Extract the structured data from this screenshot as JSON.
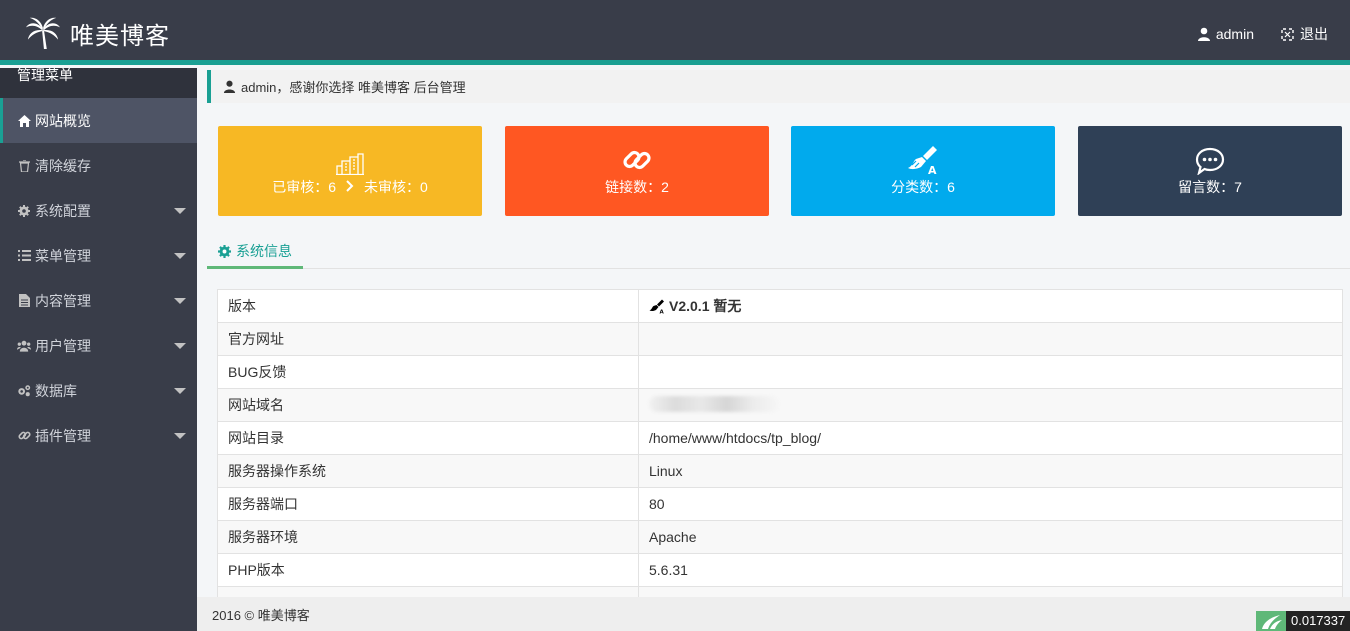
{
  "header": {
    "logo_text": "唯美博客",
    "user_label": "admin",
    "logout_label": "退出"
  },
  "sidebar": {
    "title": "管理菜单",
    "items": [
      {
        "label": "网站概览",
        "icon": "home-icon"
      },
      {
        "label": "清除缓存",
        "icon": "trash-icon"
      },
      {
        "label": "系统配置",
        "icon": "gear-icon"
      },
      {
        "label": "菜单管理",
        "icon": "list-icon"
      },
      {
        "label": "内容管理",
        "icon": "file-icon"
      },
      {
        "label": "用户管理",
        "icon": "users-icon"
      },
      {
        "label": "数据库",
        "icon": "cogs-icon"
      },
      {
        "label": "插件管理",
        "icon": "link-icon"
      }
    ]
  },
  "welcome": {
    "text": "admin，感谢你选择 唯美博客 后台管理"
  },
  "cards": {
    "audit": {
      "approved": "已审核：6",
      "pending": "未审核：0",
      "color": "#f7b824"
    },
    "links": {
      "label": "链接数：2",
      "color": "#ff5722"
    },
    "categories": {
      "label": "分类数：6",
      "color": "#01aaed"
    },
    "messages": {
      "label": "留言数：7",
      "color": "#2f4056"
    }
  },
  "tab": {
    "label": "系统信息"
  },
  "info": {
    "rows": [
      {
        "key": "版本",
        "value": "V2.0.1 暂无"
      },
      {
        "key": "官方网址",
        "value": ""
      },
      {
        "key": "BUG反馈",
        "value": ""
      },
      {
        "key": "网站域名",
        "value": ""
      },
      {
        "key": "网站目录",
        "value": "/home/www/htdocs/tp_blog/"
      },
      {
        "key": "服务器操作系统",
        "value": "Linux"
      },
      {
        "key": "服务器端口",
        "value": "80"
      },
      {
        "key": "服务器环境",
        "value": "Apache"
      },
      {
        "key": "PHP版本",
        "value": "5.6.31"
      },
      {
        "key": "",
        "value": ""
      }
    ]
  },
  "footer": {
    "copyright": "2016 © 唯美博客"
  },
  "timer": {
    "value": "0.017337"
  },
  "colors": {
    "header_bg": "#393d49",
    "accent": "#1aa094",
    "tab_underline": "#5fb878"
  }
}
